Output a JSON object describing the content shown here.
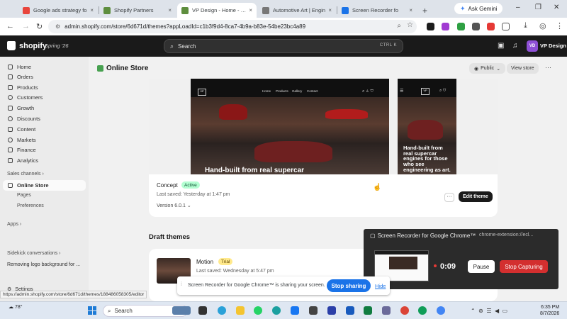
{
  "browser": {
    "tabs": [
      {
        "title": "Google ads strategy fo",
        "color": "#e8453c"
      },
      {
        "title": "Shopify Partners",
        "color": "#5e8e3e"
      },
      {
        "title": "VP Design - Home - Sh",
        "color": "#5e8e3e"
      },
      {
        "title": "Automotive Art | Engin",
        "color": "#777777"
      },
      {
        "title": "Screen Recorder fo",
        "color": "#1a73e8"
      }
    ],
    "new_tab": "+",
    "gemini_label": "Ask Gemini",
    "url": "admin.shopify.com/store/6d671d/themes?appLoadId=c1b3f9d4-8ca7-4b9a-b83e-54be23bc4a89",
    "close_glyph": "×"
  },
  "shopify": {
    "brand": "shopify",
    "edition": "Spring '26",
    "search_placeholder": "Search",
    "search_shortcut": "CTRL  K",
    "store_initials": "VD",
    "store_name": "VP Design"
  },
  "sidebar": {
    "items": [
      {
        "label": "Home"
      },
      {
        "label": "Orders"
      },
      {
        "label": "Products"
      },
      {
        "label": "Customers"
      },
      {
        "label": "Growth"
      },
      {
        "label": "Discounts"
      },
      {
        "label": "Content"
      },
      {
        "label": "Markets"
      },
      {
        "label": "Finance"
      },
      {
        "label": "Analytics"
      }
    ],
    "sales_channels": "Sales channels",
    "online_store": "Online Store",
    "sub_pages": "Pages",
    "sub_preferences": "Preferences",
    "apps": "Apps",
    "sidekick": "Sidekick conversations",
    "conversation": "Removing logo background for ...",
    "settings": "Settings"
  },
  "main": {
    "title": "Online Store",
    "public_label": "Public",
    "view_store_label": "View store",
    "more": "···",
    "current_theme": {
      "hero_desktop": "Hand-built from real supercar",
      "hero_mobile": "Hand-built from real supercar engines for those who see engineering as art.",
      "desktop_nav": [
        "Home",
        "Products",
        "Gallery",
        "Contact"
      ],
      "logo": "VP",
      "name": "Concept",
      "badge": "Active",
      "saved": "Last saved: Yesterday at 1:47 pm",
      "version": "Version 6.0.1",
      "more": "···",
      "edit_label": "Edit theme"
    },
    "draft_title": "Draft themes",
    "draft": {
      "name": "Motion",
      "badge": "Trial",
      "saved": "Last saved: Wednesday at 5:47 pm"
    }
  },
  "recorder": {
    "title": "Screen Recorder for Google Chrome™",
    "url": "chrome-extension://ecl...",
    "time": "0:09",
    "pause_label": "Pause",
    "stop_label": "Stop Capturing"
  },
  "share_bar": {
    "text": "Screen Recorder for Google Chrome™ is sharing your screen.",
    "stop_label": "Stop sharing",
    "hide_label": "Hide"
  },
  "status_url": "https://admin.shopify.com/store/6d671d/themes/188486058305/editor",
  "taskbar": {
    "weather": "78°",
    "search_placeholder": "Search",
    "time": "6:35 PM",
    "date": "8/7/2026"
  },
  "colors": {
    "accent_blue": "#1a73e8",
    "stop_red": "#d32f2f",
    "active_badge": "#b4fed2",
    "trial_badge": "#ffe98b"
  }
}
